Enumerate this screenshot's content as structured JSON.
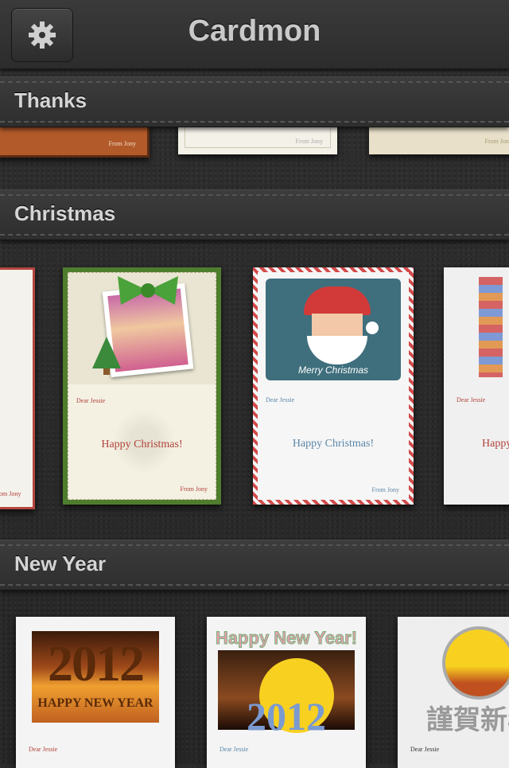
{
  "app": {
    "title": "Cardmon"
  },
  "toolbar": {
    "settings_icon": "gear-icon"
  },
  "sections": [
    {
      "title": "Thanks"
    },
    {
      "title": "Christmas"
    },
    {
      "title": "New Year"
    }
  ],
  "thanks_cards": [
    {
      "from": "From Jony",
      "color": "#b25a2a"
    },
    {
      "from": "From Jony",
      "color": "#f3f1e8"
    },
    {
      "from": "From Jony",
      "color": "#e8e0c8"
    }
  ],
  "christmas_cards": [
    {
      "from": "om Jony",
      "frame": "#b5463f"
    },
    {
      "dear": "Dear Jessie",
      "message": "Happy Christmas!",
      "from": "From Jony",
      "frame": "#4f7d2e",
      "msg_color": "#b0423a"
    },
    {
      "dear": "Dear Jessie",
      "message": "Happy Christmas!",
      "from": "From Jony",
      "frame": "#c43a3a",
      "overlay": "Merry Christmas",
      "msg_color": "#5a86a8"
    },
    {
      "dear": "Dear Jessie",
      "message": "Happy",
      "frame": "#f0f0f0"
    }
  ],
  "newyear_cards": [
    {
      "year": "2012",
      "greeting": "HAPPY NEW YEAR",
      "dear": "Dear Jessie"
    },
    {
      "headline": "Happy New Year!",
      "year": "2012",
      "dear": "Dear Jessie"
    },
    {
      "kanji": "謹賀新年",
      "dear": "Dear Jessie"
    }
  ]
}
